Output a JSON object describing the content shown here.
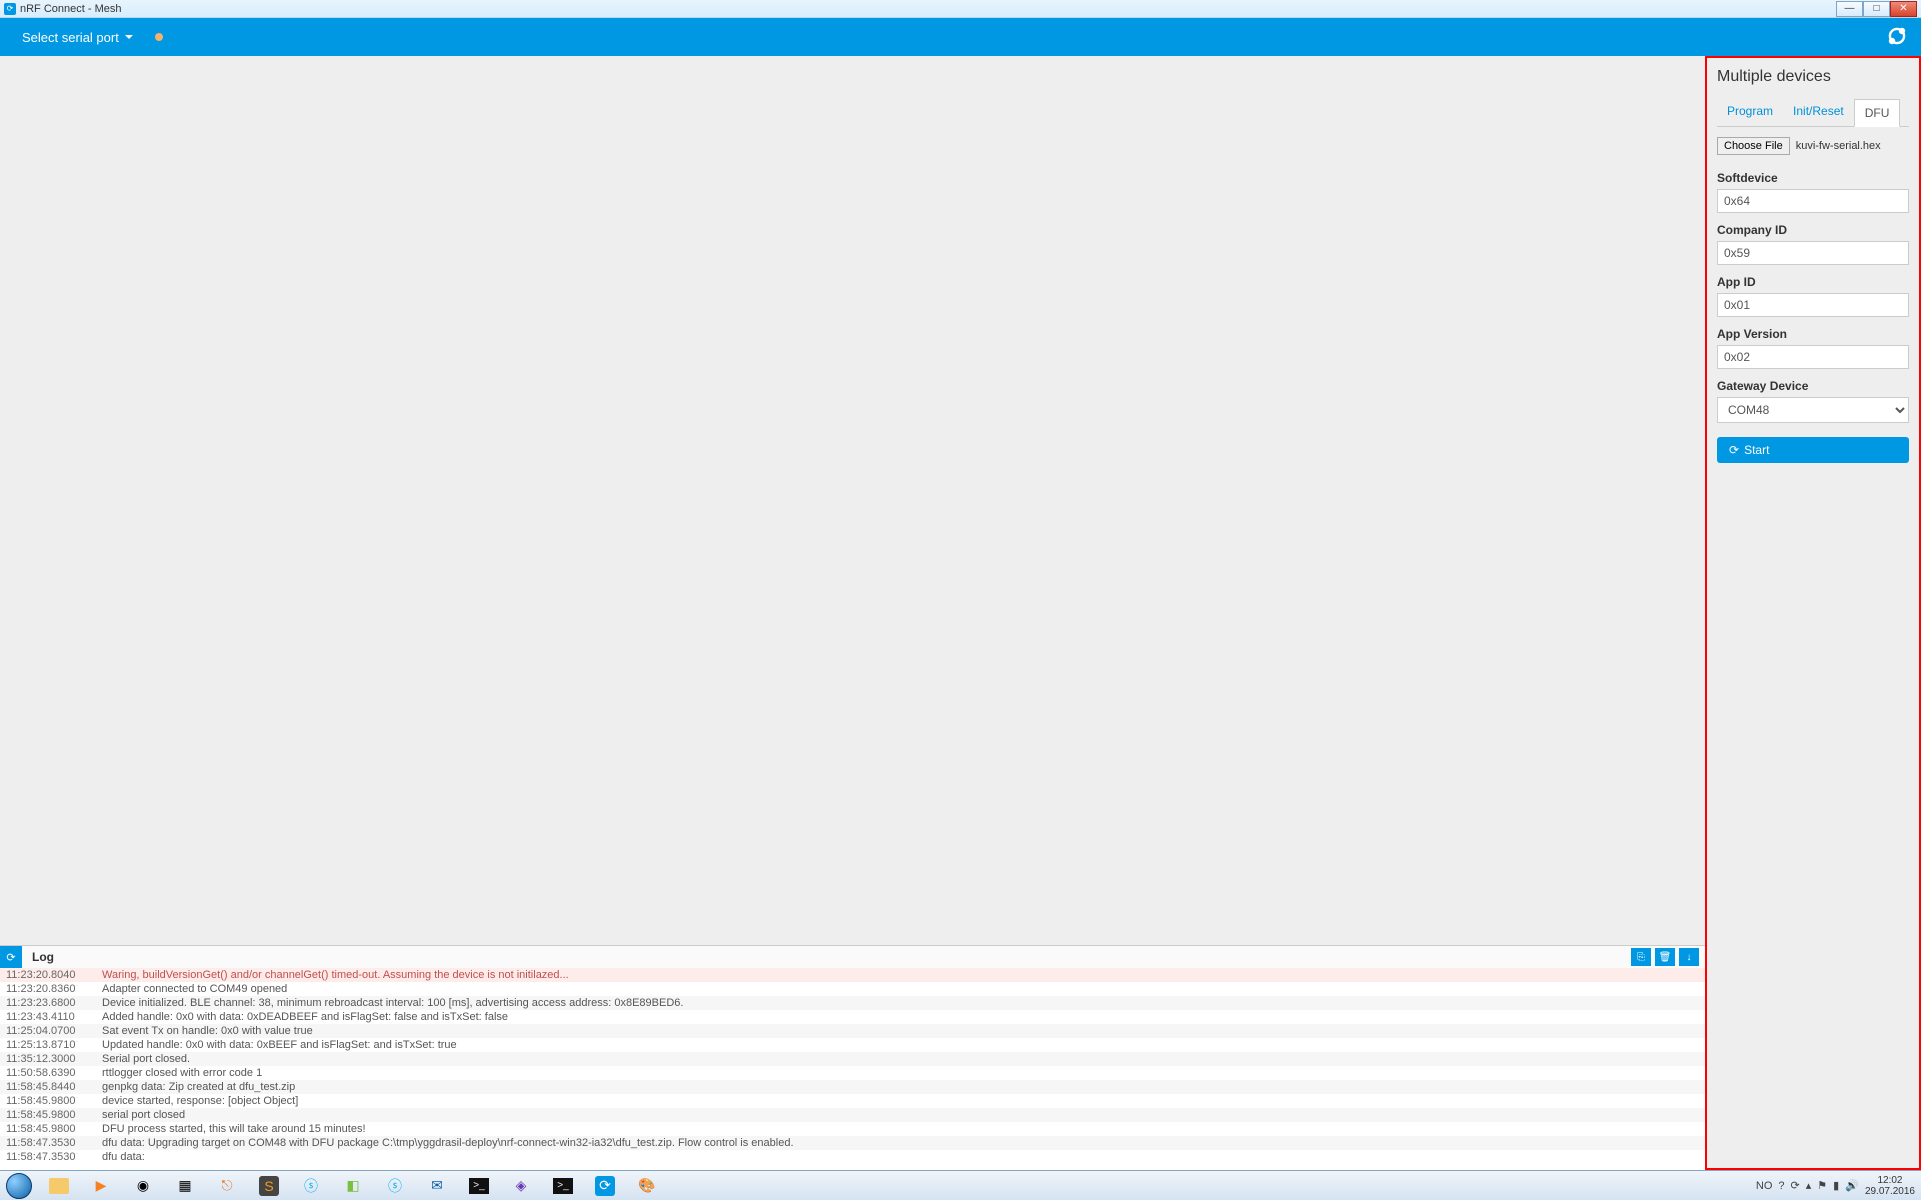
{
  "window": {
    "title": "nRF Connect - Mesh"
  },
  "header": {
    "port_label": "Select serial port"
  },
  "right_panel": {
    "title": "Multiple devices",
    "tabs": {
      "program": "Program",
      "init_reset": "Init/Reset",
      "dfu": "DFU"
    },
    "file": {
      "button": "Choose File",
      "name": "kuvi-fw-serial.hex"
    },
    "fields": {
      "softdevice": {
        "label": "Softdevice",
        "value": "0x64"
      },
      "company_id": {
        "label": "Company ID",
        "value": "0x59"
      },
      "app_id": {
        "label": "App ID",
        "value": "0x01"
      },
      "app_version": {
        "label": "App Version",
        "value": "0x02"
      },
      "gateway_device": {
        "label": "Gateway Device",
        "value": "COM48"
      }
    },
    "start_label": "Start"
  },
  "log": {
    "title": "Log",
    "rows": [
      {
        "ts": "11:23:20.8040",
        "msg": "Waring, buildVersionGet() and/or channelGet() timed-out. Assuming the device is not initilazed...",
        "warn": true
      },
      {
        "ts": "11:23:20.8360",
        "msg": "Adapter connected to COM49 opened"
      },
      {
        "ts": "11:23:23.6800",
        "msg": "Device initialized. BLE channel: 38, minimum rebroadcast interval: 100 [ms], advertising access address: 0x8E89BED6."
      },
      {
        "ts": "11:23:43.4110",
        "msg": "Added handle: 0x0 with data: 0xDEADBEEF and isFlagSet: false and isTxSet: false"
      },
      {
        "ts": "11:25:04.0700",
        "msg": "Sat event Tx on handle: 0x0 with value true"
      },
      {
        "ts": "11:25:13.8710",
        "msg": "Updated handle: 0x0 with data: 0xBEEF and isFlagSet: and isTxSet: true"
      },
      {
        "ts": "11:35:12.3000",
        "msg": "Serial port closed."
      },
      {
        "ts": "11:50:58.6390",
        "msg": "rttlogger closed with error code 1"
      },
      {
        "ts": "11:58:45.8440",
        "msg": "genpkg data: Zip created at dfu_test.zip"
      },
      {
        "ts": "11:58:45.9800",
        "msg": "device started, response: [object Object]"
      },
      {
        "ts": "11:58:45.9800",
        "msg": "serial port closed"
      },
      {
        "ts": "11:58:45.9800",
        "msg": "DFU process started, this will take around 15 minutes!"
      },
      {
        "ts": "11:58:47.3530",
        "msg": "dfu data: Upgrading target on COM48 with DFU package C:\\tmp\\yggdrasil-deploy\\nrf-connect-win32-ia32\\dfu_test.zip. Flow control is enabled."
      },
      {
        "ts": "11:58:47.3530",
        "msg": "dfu data:"
      }
    ]
  },
  "tray": {
    "lang": "NO",
    "time": "12:02",
    "date": "29.07.2016"
  },
  "colors": {
    "primary": "#0098e3",
    "highlight_border": "#ff0000"
  }
}
